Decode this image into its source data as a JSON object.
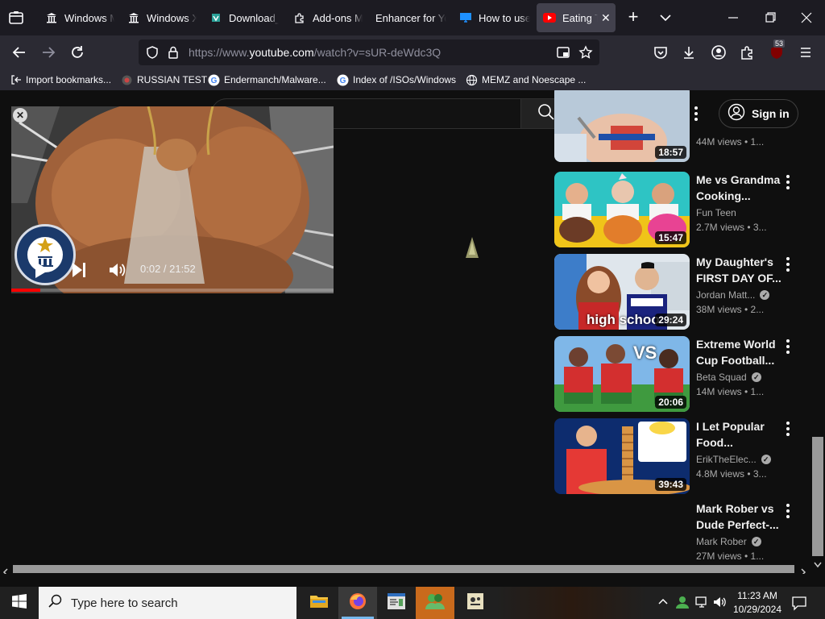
{
  "browser": {
    "tabs": [
      {
        "label": "Windows M",
        "icon": "museum-icon"
      },
      {
        "label": "Windows X",
        "icon": "museum-icon"
      },
      {
        "label": "Download_",
        "icon": "download-site-icon"
      },
      {
        "label": "Add-ons M",
        "icon": "puzzle-icon"
      },
      {
        "label": "Enhancer for Yo",
        "icon": ""
      },
      {
        "label": "How to use",
        "icon": "monitor-icon"
      },
      {
        "label": "Eating Tl",
        "icon": "youtube-icon"
      }
    ],
    "url_prefix": "https://www.",
    "url_domain": "youtube.com",
    "url_path": "/watch?v=sUR-deWdc3Q",
    "extension_badge": "53",
    "bookmarks": [
      {
        "label": "Import bookmarks..."
      },
      {
        "label": "RUSSIAN TEST"
      },
      {
        "label": "Endermanch/Malware..."
      },
      {
        "label": "Index of /ISOs/Windows"
      },
      {
        "label": "MEMZ and Noescape ..."
      }
    ]
  },
  "youtube": {
    "sign_in": "Sign in",
    "mini_player": {
      "time": "0:02 / 21:52",
      "progress": 0.0015
    },
    "videos": [
      {
        "title_1": "",
        "title_2": "",
        "channel": "",
        "meta": "44M views  •  1...",
        "duration": "18:57",
        "verified": false
      },
      {
        "title_1": "Me vs Grandma",
        "title_2": "Cooking...",
        "channel": "Fun Teen",
        "meta": "2.7M views  •  3...",
        "duration": "15:47",
        "verified": false
      },
      {
        "title_1": "My Daughter's",
        "title_2": "FIRST DAY OF...",
        "channel": "Jordan Matt...",
        "meta": "38M views  •  2...",
        "duration": "29:24",
        "verified": true,
        "overlay": "high schoo"
      },
      {
        "title_1": "Extreme World",
        "title_2": "Cup Football...",
        "channel": "Beta Squad",
        "meta": "14M views  •  1...",
        "duration": "20:06",
        "verified": true,
        "overlay": "VS"
      },
      {
        "title_1": "I Let Popular",
        "title_2": "Food...",
        "channel": "ErikTheElec...",
        "meta": "4.8M views  •  3...",
        "duration": "39:43",
        "verified": true
      },
      {
        "title_1": "Mark Rober vs",
        "title_2": "Dude Perfect-...",
        "channel": "Mark Rober",
        "meta": "27M views  •  1...",
        "duration": "",
        "verified": true
      }
    ]
  },
  "taskbar": {
    "search_placeholder": "Type here to search",
    "time": "11:23 AM",
    "date": "10/29/2024"
  }
}
